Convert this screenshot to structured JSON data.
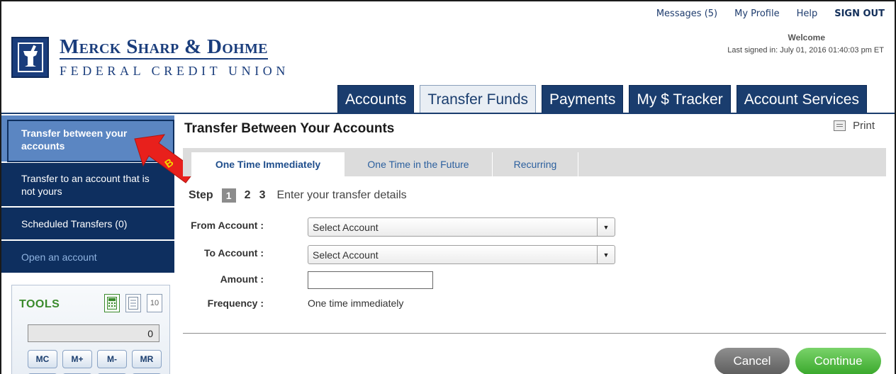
{
  "top_links": {
    "messages": "Messages (5)",
    "profile": "My Profile",
    "help": "Help",
    "signout": "SIGN OUT"
  },
  "welcome": "Welcome",
  "last_signed": "Last signed in: July 01, 2016 01:40:03 pm ET",
  "logo": {
    "name": "Merck Sharp & Dohme",
    "subtitle": "FEDERAL CREDIT UNION"
  },
  "tabs": [
    {
      "label": "Accounts"
    },
    {
      "label": "Transfer Funds"
    },
    {
      "label": "Payments"
    },
    {
      "label": "My $ Tracker"
    },
    {
      "label": "Account Services"
    }
  ],
  "sidebar": {
    "items": [
      {
        "label": "Transfer between your accounts"
      },
      {
        "label": "Transfer to an account that is not yours"
      },
      {
        "label": "Scheduled Transfers (0)"
      },
      {
        "label": "Open an account"
      }
    ]
  },
  "annotation": {
    "letter": "B",
    "color": "#e8201c",
    "text_color": "#f5d400"
  },
  "tools": {
    "title": "TOOLS",
    "calendar_day": "10",
    "display": "0",
    "buttons": [
      "MC",
      "M+",
      "M-",
      "MR"
    ]
  },
  "main": {
    "title": "Transfer Between Your Accounts",
    "print": "Print"
  },
  "subtabs": [
    {
      "label": "One Time Immediately"
    },
    {
      "label": "One Time in the Future"
    },
    {
      "label": "Recurring"
    }
  ],
  "steps": {
    "word": "Step",
    "numbers": [
      "1",
      "2",
      "3"
    ],
    "description": "Enter your transfer details"
  },
  "form": {
    "from_label": "From Account :",
    "from_value": "Select Account",
    "to_label": "To Account :",
    "to_value": "Select Account",
    "amount_label": "Amount :",
    "amount_value": "",
    "frequency_label": "Frequency :",
    "frequency_value": "One time immediately"
  },
  "buttons": {
    "cancel": "Cancel",
    "continue": "Continue"
  },
  "colors": {
    "brand_navy": "#1a3d6e",
    "sidebar_active": "#5b86c2",
    "continue_green": "#3aa82c",
    "cancel_gray": "#5e5e5e"
  }
}
